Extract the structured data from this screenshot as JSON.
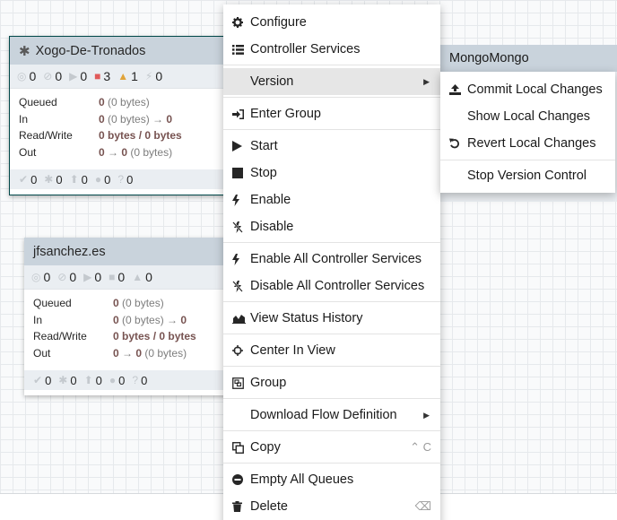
{
  "groups": [
    {
      "name": "Xogo-De-Tronados",
      "stats": [
        "0",
        "0",
        "0",
        "3",
        "1",
        "0"
      ],
      "table": [
        {
          "label": "Queued",
          "bold": "0",
          "rest": " (0 bytes)"
        },
        {
          "label": "In",
          "bold": "0",
          "rest": " (0 bytes) → ",
          "bold2": "0"
        },
        {
          "label": "Read/Write",
          "bold": "0 bytes / 0 bytes",
          "rest": ""
        },
        {
          "label": "Out",
          "bold": "0",
          "rest": " → ",
          "bold2": "0",
          "rest2": " (0 bytes)"
        }
      ],
      "footer": [
        "0",
        "0",
        "0",
        "0",
        "0"
      ]
    },
    {
      "name": "jfsanchez.es",
      "stats": [
        "0",
        "0",
        "0",
        "0",
        "0"
      ],
      "table": [
        {
          "label": "Queued",
          "bold": "0",
          "rest": " (0 bytes)"
        },
        {
          "label": "In",
          "bold": "0",
          "rest": " (0 bytes) → ",
          "bold2": "0"
        },
        {
          "label": "Read/Write",
          "bold": "0 bytes / 0 bytes",
          "rest": ""
        },
        {
          "label": "Out",
          "bold": "0",
          "rest": " → ",
          "bold2": "0",
          "rest2": " (0 bytes)"
        }
      ],
      "footer": [
        "0",
        "0",
        "0",
        "0",
        "0"
      ]
    }
  ],
  "third_group": {
    "name": "MongoMongo"
  },
  "menu": {
    "configure": "Configure",
    "controller_services": "Controller Services",
    "version": "Version",
    "enter_group": "Enter Group",
    "start": "Start",
    "stop": "Stop",
    "enable": "Enable",
    "disable": "Disable",
    "enable_all_cs": "Enable All Controller Services",
    "disable_all_cs": "Disable All Controller Services",
    "view_status_history": "View Status History",
    "center_in_view": "Center In View",
    "group": "Group",
    "download_flow_definition": "Download Flow Definition",
    "copy": "Copy",
    "copy_shortcut": "⌃ C",
    "empty_all_queues": "Empty All Queues",
    "delete": "Delete",
    "delete_shortcut": "⌫"
  },
  "submenu": {
    "commit": "Commit Local Changes",
    "show": "Show Local Changes",
    "revert": "Revert Local Changes",
    "stop_vc": "Stop Version Control"
  },
  "icons": {
    "configure": "gear-icon",
    "controller_services": "list-icon",
    "enter_group": "sign-in-icon",
    "start": "play-icon",
    "stop": "stop-icon",
    "enable": "bolt-icon",
    "disable": "bolt-slash-icon",
    "view_status_history": "area-chart-icon",
    "center_in_view": "crosshairs-icon",
    "group": "group-icon",
    "copy": "copy-icon",
    "empty_all_queues": "minus-circle-icon",
    "delete": "trash-icon",
    "commit": "upload-icon",
    "revert": "undo-icon"
  },
  "colors": {
    "selected_border": "#004849",
    "header_bg": "#c9d3dc",
    "stats_bg": "#eaeef2",
    "invalid_red": "#e05a5a",
    "warning_amber": "#e0a43a",
    "bold_value": "#775351"
  }
}
